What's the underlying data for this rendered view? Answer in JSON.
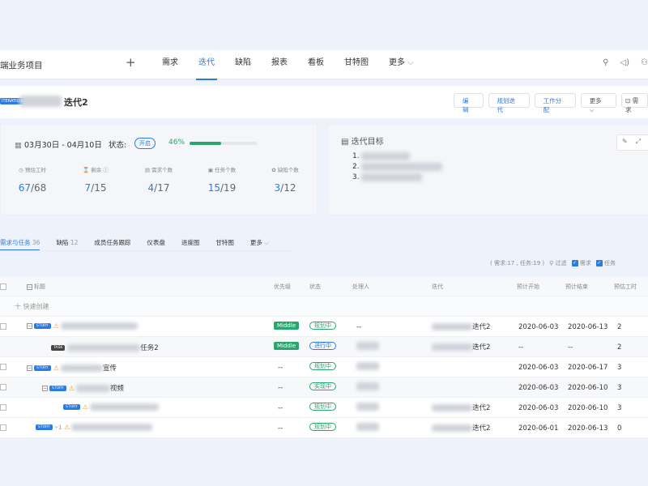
{
  "nav": {
    "project": "端业务项目",
    "add_icon": "plus-icon",
    "tabs": [
      {
        "label": "需求"
      },
      {
        "label": "迭代",
        "active": true
      },
      {
        "label": "缺陷"
      },
      {
        "label": "报表"
      },
      {
        "label": "看板"
      },
      {
        "label": "甘特图"
      },
      {
        "label": "更多"
      }
    ],
    "icons": [
      "search-icon",
      "sound-icon",
      "user-icon"
    ]
  },
  "header": {
    "sprint_tag": "ITERATION",
    "title": "迭代2",
    "buttons": {
      "edit": "编辑",
      "plan": "规划迭代",
      "assign": "工作分配",
      "more": "更多"
    },
    "extra": "需求"
  },
  "summary": {
    "date_range": "03月30日  -  04月10日",
    "status_label": "状态:",
    "status_value": "开启",
    "progress_pct_label": "46%",
    "progress_value": 46,
    "stats": [
      {
        "label": "预估工时",
        "done": "67",
        "total": "/68"
      },
      {
        "label": "剩余 ⓘ",
        "done": "7",
        "total": "/15"
      },
      {
        "label": "需求个数",
        "done": "4",
        "total": "/17"
      },
      {
        "label": "任务个数",
        "done": "15",
        "total": "/19"
      },
      {
        "label": "缺陷个数",
        "done": "3",
        "total": "/12"
      }
    ]
  },
  "goals": {
    "title": "迭代目标",
    "items": [
      "1.",
      "2.",
      "3."
    ]
  },
  "subtabs": {
    "items": [
      {
        "label": "需求与任务",
        "count": "36",
        "active": true
      },
      {
        "label": "缺陷",
        "count": "12"
      },
      {
        "label": "成员任务跟踪",
        "count": ""
      },
      {
        "label": "仪表盘",
        "count": ""
      },
      {
        "label": "进度图",
        "count": ""
      },
      {
        "label": "甘特图",
        "count": ""
      },
      {
        "label": "更多",
        "count": ""
      }
    ]
  },
  "filter": {
    "counts": "( 需求:17 , 任务:19 )",
    "filter_label": "过滤",
    "show_req": "需求",
    "show_task": "任务"
  },
  "table": {
    "headers": {
      "title": "标题",
      "priority": "优先级",
      "status": "状态",
      "owner": "处理人",
      "iteration": "迭代",
      "start": "预计开始",
      "end": "预计结束",
      "hours": "预估工时"
    },
    "quick_create": "十 快速创建",
    "rows": [
      {
        "type": "STORY",
        "title": "",
        "priority": "Middle",
        "status": "规划中",
        "owner": "--",
        "iteration": "迭代2",
        "start": "2020-06-03",
        "end": "2020-06-13",
        "hours": "2"
      },
      {
        "type": "TASK",
        "title": "任务2",
        "priority": "Middle",
        "status": "进行中",
        "owner": "",
        "iteration": "迭代2",
        "start": "--",
        "end": "--",
        "hours": "2"
      },
      {
        "type": "STORY",
        "title": "宣传",
        "priority": "--",
        "status": "规划中",
        "owner": "",
        "iteration": "",
        "start": "2020-06-03",
        "end": "2020-06-17",
        "hours": "3"
      },
      {
        "type": "STORY",
        "title": "视频",
        "priority": "--",
        "status": "实现中",
        "owner": "",
        "iteration": "",
        "start": "2020-06-03",
        "end": "2020-06-10",
        "hours": "3"
      },
      {
        "type": "STORY",
        "title": "",
        "priority": "--",
        "status": "规划中",
        "owner": "",
        "iteration": "迭代2",
        "start": "2020-06-03",
        "end": "2020-06-10",
        "hours": "3"
      },
      {
        "type": "STORY",
        "title": "",
        "sub_count": "1",
        "priority": "--",
        "status": "规划中",
        "owner": "",
        "iteration": "迭代2",
        "start": "2020-06-01",
        "end": "2020-06-13",
        "hours": "0"
      }
    ]
  }
}
